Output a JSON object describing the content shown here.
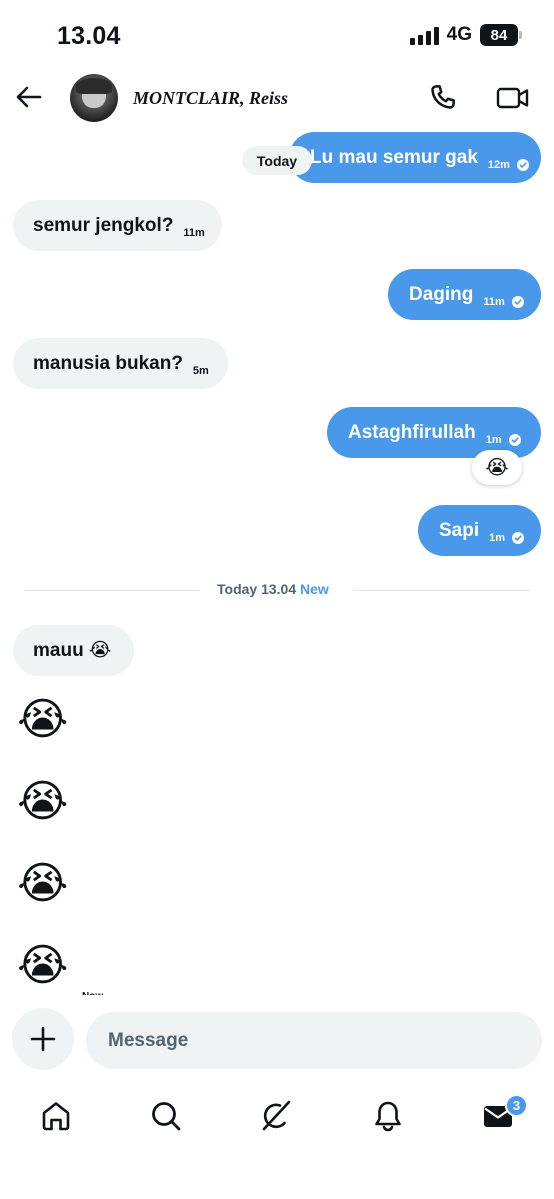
{
  "status_bar": {
    "time": "13.04",
    "network": "4G",
    "battery": "84"
  },
  "header": {
    "contact_name": "MONTCLAIR, Reiss"
  },
  "today_chip": "Today",
  "messages": [
    {
      "side": "sent",
      "text": "Lu mau semur gak",
      "time": "12m",
      "status": "read"
    },
    {
      "side": "received",
      "text": "semur jengkol?",
      "time": "11m"
    },
    {
      "side": "sent",
      "text": "Daging",
      "time": "11m",
      "status": "read"
    },
    {
      "side": "received",
      "text": "manusia bukan?",
      "time": "5m"
    },
    {
      "side": "sent",
      "text": "Astaghfirullah",
      "time": "1m",
      "status": "read",
      "reaction": "😭"
    },
    {
      "side": "sent",
      "text": "Sapi",
      "time": "1m",
      "status": "read"
    }
  ],
  "divider": {
    "label": "Today 13.04",
    "new_label": "New"
  },
  "new_messages": [
    {
      "side": "received",
      "text": "mauu 😭"
    },
    {
      "side": "received",
      "text": "😭"
    },
    {
      "side": "received",
      "text": "😭"
    },
    {
      "side": "received",
      "text": "😭"
    },
    {
      "side": "received",
      "text": "😭"
    }
  ],
  "truncated_label": "Now",
  "composer": {
    "placeholder": "Message"
  },
  "bottom_nav": {
    "items": [
      {
        "icon": "home-icon"
      },
      {
        "icon": "search-icon"
      },
      {
        "icon": "grok-icon"
      },
      {
        "icon": "bell-icon"
      },
      {
        "icon": "mail-icon",
        "badge": "3"
      }
    ]
  },
  "colors": {
    "accent": "#4a98e9",
    "bubble_received": "#eff3f4",
    "text": "#0f1419",
    "muted": "#536471"
  }
}
